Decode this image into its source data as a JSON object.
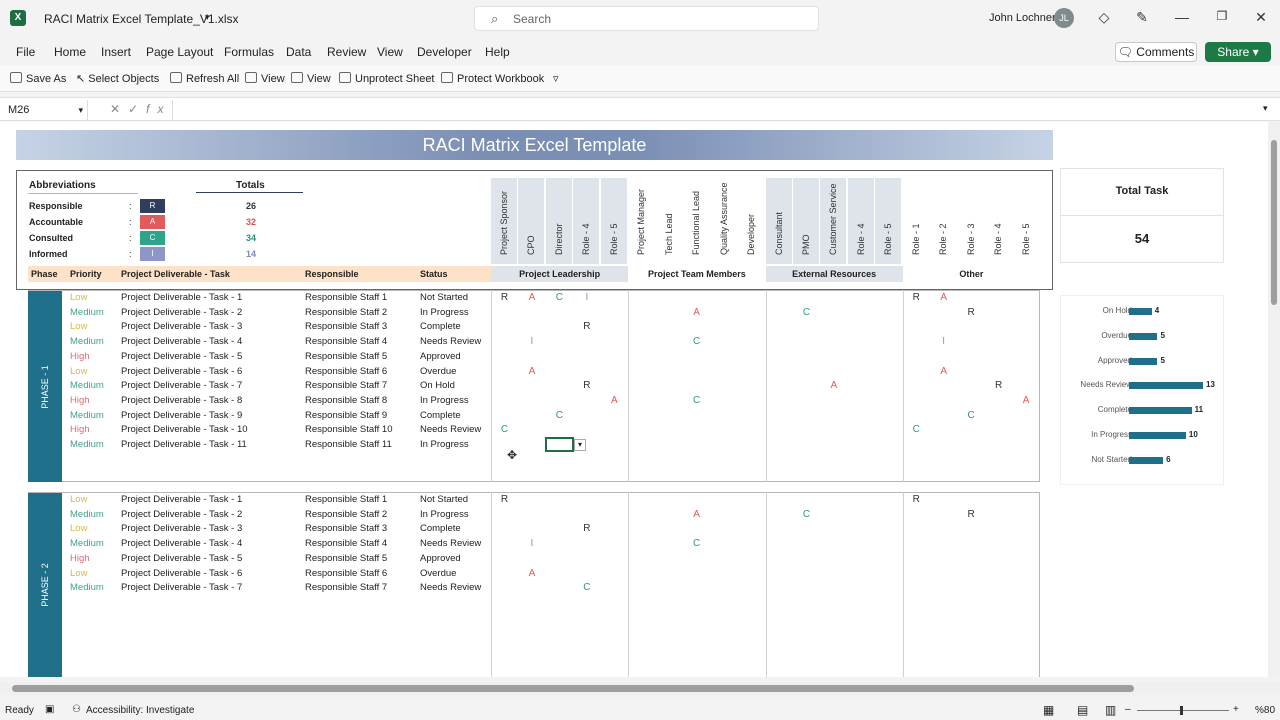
{
  "window": {
    "filename": "RACI Matrix Excel Template_V1.xlsx",
    "search_placeholder": "Search",
    "user": "John Lochner",
    "user_initials": "JL"
  },
  "menu": [
    "File",
    "Home",
    "Insert",
    "Page Layout",
    "Formulas",
    "Data",
    "Review",
    "View",
    "Developer",
    "Help"
  ],
  "buttons": {
    "comments": "Comments",
    "share": "Share"
  },
  "ribbon": {
    "save_as": "Save As",
    "select_objects": "Select Objects",
    "refresh_all": "Refresh All",
    "view1": "View",
    "view2": "View",
    "unprotect": "Unprotect Sheet",
    "protect": "Protect Workbook"
  },
  "formula": {
    "namebox": "M26",
    "fx": "fx"
  },
  "sheet": {
    "title": "RACI Matrix Excel Template",
    "abbr_header": "Abbreviations",
    "totals_header": "Totals",
    "abbreviations": [
      {
        "name": "Responsible",
        "letter": "R",
        "total": "26",
        "color": "#2f3e5c",
        "tcolor": "#333333"
      },
      {
        "name": "Accountable",
        "letter": "A",
        "total": "32",
        "color": "#e15b5b",
        "tcolor": "#d9534f"
      },
      {
        "name": "Consulted",
        "letter": "C",
        "total": "34",
        "color": "#2ea58a",
        "tcolor": "#2a8f78"
      },
      {
        "name": "Informed",
        "letter": "I",
        "total": "14",
        "color": "#8f95c9",
        "tcolor": "#7f86c0"
      }
    ],
    "roles": [
      "Project Sponsor",
      "CPO",
      "Director",
      "Role - 4",
      "Role - 5",
      "Project Manager",
      "Tech Lead",
      "Functional Lead",
      "Quality Assurance",
      "Developer",
      "Consultant",
      "PMO",
      "Customer Service",
      "Role - 4",
      "Role - 5",
      "Role - 1",
      "Role - 2",
      "Role - 3",
      "Role - 4",
      "Role - 5"
    ],
    "groups": [
      "Project Leadership",
      "Project Team Members",
      "External Resources",
      "Other"
    ],
    "columns": {
      "phase": "Phase",
      "priority": "Priority",
      "deliverable": "Project Deliverable - Task",
      "responsible": "Responsible",
      "status": "Status"
    },
    "phase1_label": "PHASE - 1",
    "phase2_label": "PHASE - 2",
    "phase1": [
      {
        "priority": "Low",
        "task": "Project Deliverable - Task - 1",
        "resp": "Responsible Staff 1",
        "status": "Not Started",
        "marks": {
          "0": "R",
          "1": "A",
          "2": "C",
          "3": "I",
          "15": "R",
          "16": "A"
        }
      },
      {
        "priority": "Medium",
        "task": "Project Deliverable - Task - 2",
        "resp": "Responsible Staff 2",
        "status": "In Progress",
        "marks": {
          "7": "A",
          "11": "C",
          "17": "R"
        }
      },
      {
        "priority": "Low",
        "task": "Project Deliverable - Task - 3",
        "resp": "Responsible Staff 3",
        "status": "Complete",
        "marks": {
          "3": "R"
        }
      },
      {
        "priority": "Medium",
        "task": "Project Deliverable - Task - 4",
        "resp": "Responsible Staff 4",
        "status": "Needs Review",
        "marks": {
          "1": "I",
          "7": "C",
          "16": "I"
        }
      },
      {
        "priority": "High",
        "task": "Project Deliverable - Task - 5",
        "resp": "Responsible Staff 5",
        "status": "Approved",
        "marks": {}
      },
      {
        "priority": "Low",
        "task": "Project Deliverable - Task - 6",
        "resp": "Responsible Staff 6",
        "status": "Overdue",
        "marks": {
          "1": "A",
          "16": "A"
        }
      },
      {
        "priority": "Medium",
        "task": "Project Deliverable - Task - 7",
        "resp": "Responsible Staff 7",
        "status": "On Hold",
        "marks": {
          "3": "R",
          "12": "A",
          "18": "R"
        }
      },
      {
        "priority": "High",
        "task": "Project Deliverable - Task - 8",
        "resp": "Responsible Staff 8",
        "status": "In Progress",
        "marks": {
          "4": "A",
          "7": "C",
          "19": "A"
        }
      },
      {
        "priority": "Medium",
        "task": "Project Deliverable - Task - 9",
        "resp": "Responsible Staff 9",
        "status": "Complete",
        "marks": {
          "2": "C",
          "17": "C"
        }
      },
      {
        "priority": "High",
        "task": "Project Deliverable - Task - 10",
        "resp": "Responsible Staff 10",
        "status": "Needs Review",
        "marks": {
          "0": "C",
          "15": "C"
        }
      },
      {
        "priority": "Medium",
        "task": "Project Deliverable - Task - 11",
        "resp": "Responsible Staff 11",
        "status": "In Progress",
        "marks": {}
      }
    ],
    "phase2": [
      {
        "priority": "Low",
        "task": "Project Deliverable - Task - 1",
        "resp": "Responsible Staff 1",
        "status": "Not Started",
        "marks": {
          "0": "R",
          "15": "R"
        }
      },
      {
        "priority": "Medium",
        "task": "Project Deliverable - Task - 2",
        "resp": "Responsible Staff 2",
        "status": "In Progress",
        "marks": {
          "7": "A",
          "11": "C",
          "17": "R"
        }
      },
      {
        "priority": "Low",
        "task": "Project Deliverable - Task - 3",
        "resp": "Responsible Staff 3",
        "status": "Complete",
        "marks": {
          "3": "R"
        }
      },
      {
        "priority": "Medium",
        "task": "Project Deliverable - Task - 4",
        "resp": "Responsible Staff 4",
        "status": "Needs Review",
        "marks": {
          "1": "I",
          "7": "C"
        }
      },
      {
        "priority": "High",
        "task": "Project Deliverable - Task - 5",
        "resp": "Responsible Staff 5",
        "status": "Approved",
        "marks": {}
      },
      {
        "priority": "Low",
        "task": "Project Deliverable - Task - 6",
        "resp": "Responsible Staff 6",
        "status": "Overdue",
        "marks": {
          "1": "A"
        }
      },
      {
        "priority": "Medium",
        "task": "Project Deliverable - Task - 7",
        "resp": "Responsible Staff 7",
        "status": "Needs Review",
        "marks": {
          "3": "C"
        }
      }
    ],
    "total_task_label": "Total Task",
    "total_task_value": "54",
    "colors": {
      "R": "#333333",
      "A": "#e05a5a",
      "C": "#2a9a80",
      "I": "#8a8fc8",
      "Low": "#d7b84a",
      "Medium": "#3f9f8c",
      "High": "#e06a7a",
      "band": "#1f6f8b",
      "header_orange": "#fde2c8"
    }
  },
  "chart_data": {
    "type": "bar",
    "categories": [
      "On Hold",
      "Overdue",
      "Approved",
      "Needs Review",
      "Complete",
      "In Progress",
      "Not Started"
    ],
    "values": [
      4,
      5,
      5,
      13,
      11,
      10,
      6
    ],
    "xlim": [
      0,
      13
    ]
  },
  "status": {
    "ready": "Ready",
    "accessibility": "Accessibility: Investigate",
    "zoom": "%80"
  }
}
